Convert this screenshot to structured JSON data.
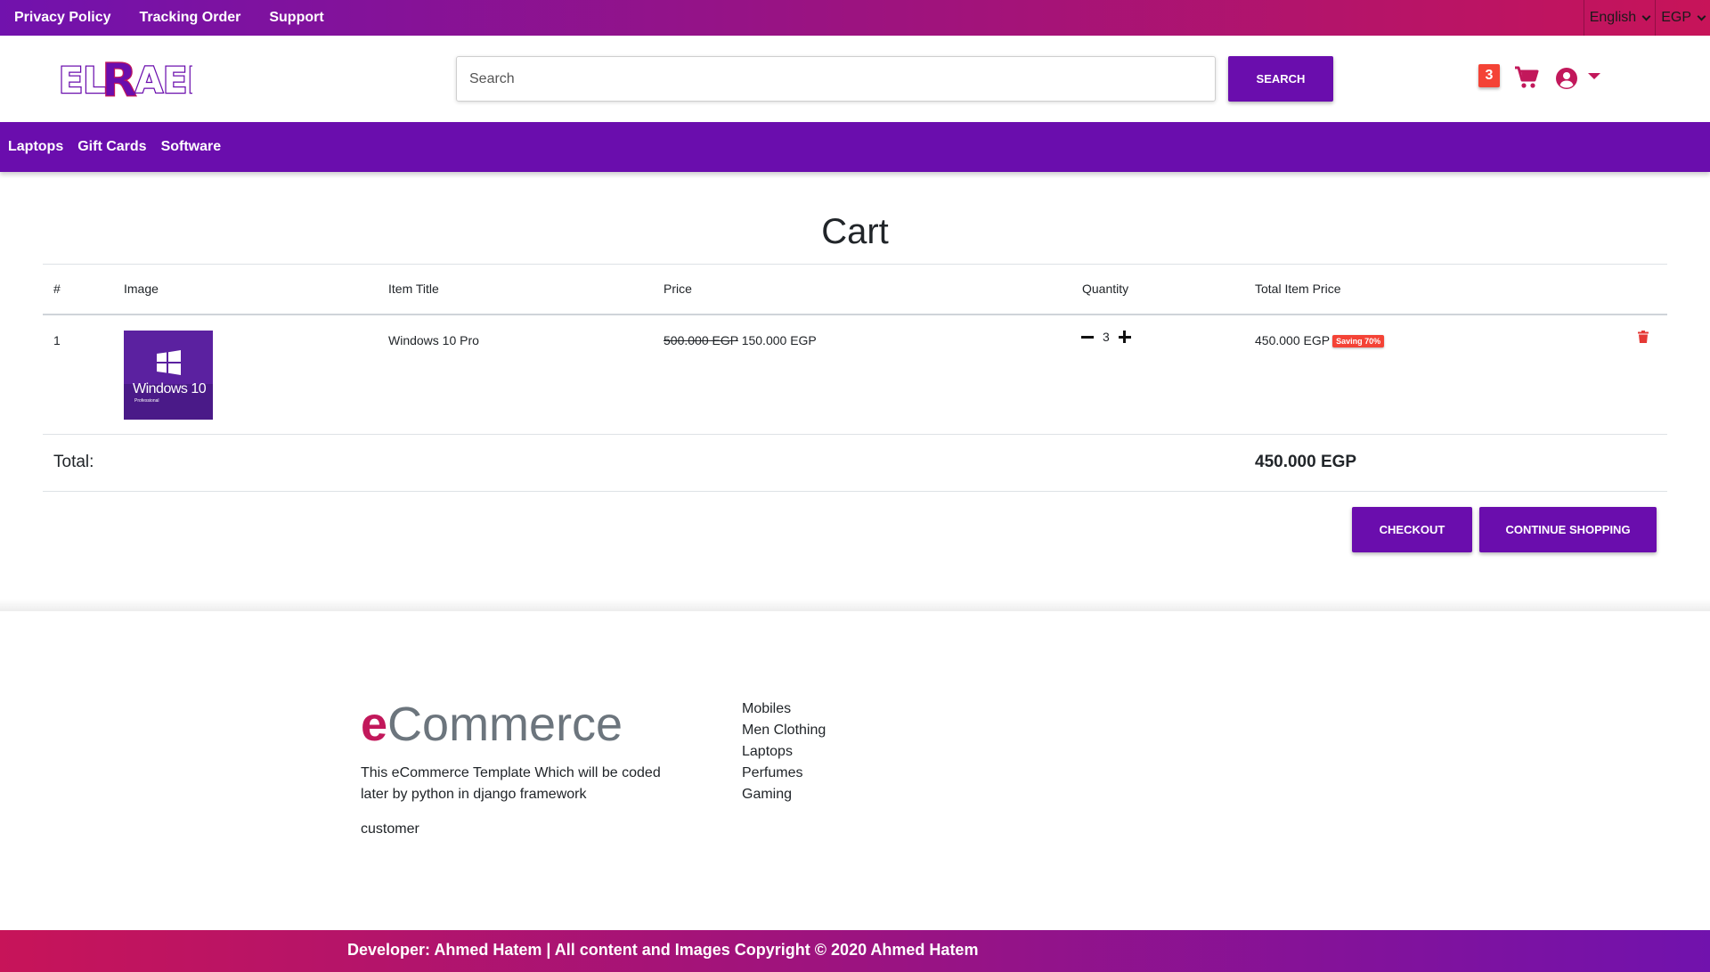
{
  "topbar": {
    "links": [
      "Privacy Policy",
      "Tracking Order",
      "Support"
    ],
    "language": "English",
    "currency": "EGP"
  },
  "header": {
    "logo_text": "ELRAEI",
    "search": {
      "placeholder": "Search",
      "button_label": "SEARCH"
    },
    "cart_count": "3",
    "icons": [
      "shopping-cart-icon",
      "user-circle-icon",
      "caret-down-icon"
    ]
  },
  "nav": {
    "items": [
      "Laptops",
      "Gift Cards",
      "Software"
    ]
  },
  "cart": {
    "title": "Cart",
    "columns": [
      "#",
      "Image",
      "Item Title",
      "Price",
      "Quantity",
      "Total Item Price"
    ],
    "items": [
      {
        "index": "1",
        "image_text": "Windows 10",
        "image_subtext": "Professional",
        "title": "Windows 10 Pro",
        "old_price": "500.000 EGP",
        "price": "150.000 EGP",
        "quantity": "3",
        "total": "450.000 EGP",
        "saving": "Saving 70%"
      }
    ],
    "total_label": "Total:",
    "total_value": "450.000 EGP",
    "checkout_label": "CHECKOUT",
    "continue_label": "CONTINUE SHOPPING"
  },
  "footer": {
    "brand_e": "e",
    "brand_rest": "Commerce",
    "description": "This eCommerce Template Which will be coded later by python in django framework",
    "customer": "customer",
    "links": [
      "Mobiles",
      "Men Clothing",
      "Laptops",
      "Perfumes",
      "Gaming"
    ],
    "copyright": "Developer: Ahmed Hatem | All content and Images Copyright © 2020 Ahmed Hatem"
  },
  "colors": {
    "primary": "#6a0dad",
    "accent": "#c2185b",
    "badge": "#f44336",
    "trash": "#e53935"
  }
}
